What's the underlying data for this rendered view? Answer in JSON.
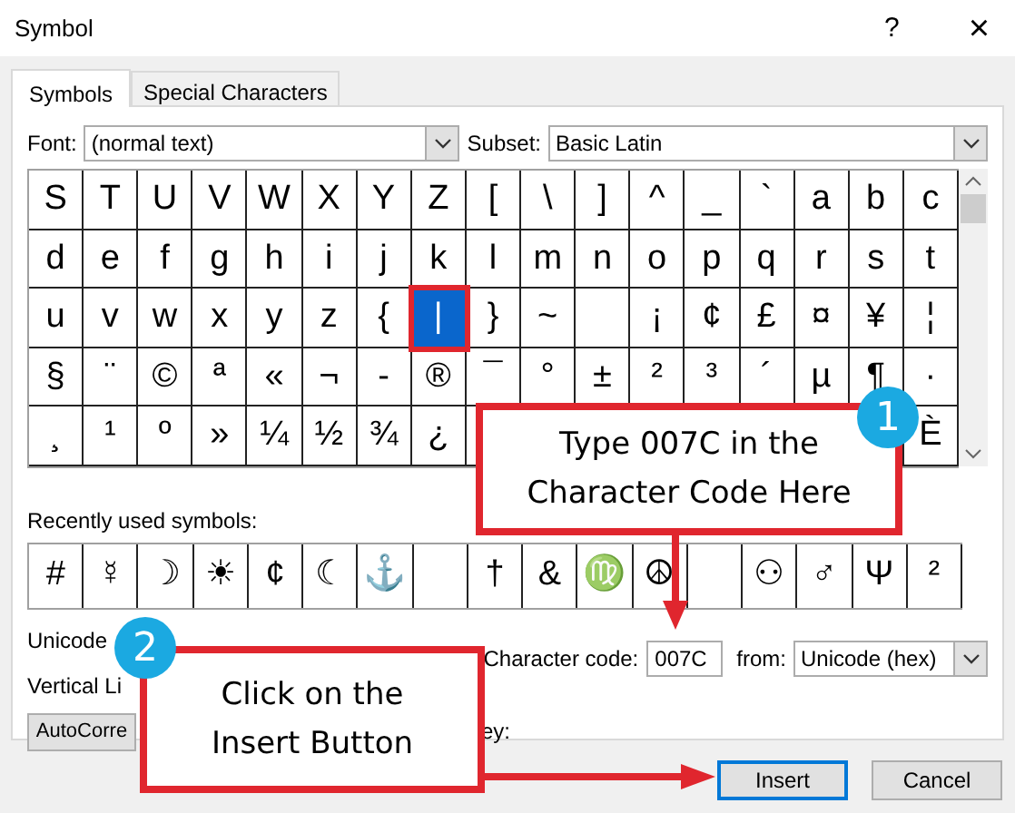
{
  "window": {
    "title": "Symbol",
    "help": "?",
    "close": "×"
  },
  "tabs": [
    {
      "label": "Symbols",
      "selected": true
    },
    {
      "label": "Special Characters",
      "selected": false
    }
  ],
  "font": {
    "label": "Font:",
    "value": "(normal text)"
  },
  "subset": {
    "label": "Subset:",
    "value": "Basic Latin"
  },
  "symbol_grid": [
    [
      {
        "c": "S",
        "selected": false
      },
      {
        "c": "T",
        "selected": false
      },
      {
        "c": "U",
        "selected": false
      },
      {
        "c": "V",
        "selected": false
      },
      {
        "c": "W",
        "selected": false
      },
      {
        "c": "X",
        "selected": false
      },
      {
        "c": "Y",
        "selected": false
      },
      {
        "c": "Z",
        "selected": false
      },
      {
        "c": "[",
        "selected": false
      },
      {
        "c": "\\",
        "selected": false
      },
      {
        "c": "]",
        "selected": false
      },
      {
        "c": "^",
        "selected": false
      },
      {
        "c": "_",
        "selected": false
      },
      {
        "c": "`",
        "selected": false
      },
      {
        "c": "a",
        "selected": false
      },
      {
        "c": "b",
        "selected": false
      },
      {
        "c": "c",
        "selected": false
      }
    ],
    [
      {
        "c": "d",
        "selected": false
      },
      {
        "c": "e",
        "selected": false
      },
      {
        "c": "f",
        "selected": false
      },
      {
        "c": "g",
        "selected": false
      },
      {
        "c": "h",
        "selected": false
      },
      {
        "c": "i",
        "selected": false
      },
      {
        "c": "j",
        "selected": false
      },
      {
        "c": "k",
        "selected": false
      },
      {
        "c": "l",
        "selected": false
      },
      {
        "c": "m",
        "selected": false
      },
      {
        "c": "n",
        "selected": false
      },
      {
        "c": "o",
        "selected": false
      },
      {
        "c": "p",
        "selected": false
      },
      {
        "c": "q",
        "selected": false
      },
      {
        "c": "r",
        "selected": false
      },
      {
        "c": "s",
        "selected": false
      },
      {
        "c": "t",
        "selected": false
      }
    ],
    [
      {
        "c": "u",
        "selected": false
      },
      {
        "c": "v",
        "selected": false
      },
      {
        "c": "w",
        "selected": false
      },
      {
        "c": "x",
        "selected": false
      },
      {
        "c": "y",
        "selected": false
      },
      {
        "c": "z",
        "selected": false
      },
      {
        "c": "{",
        "selected": false
      },
      {
        "c": "|",
        "selected": true
      },
      {
        "c": "}",
        "selected": false
      },
      {
        "c": "~",
        "selected": false
      },
      {
        "selected": false
      },
      {
        "c": "¡",
        "selected": false
      },
      {
        "c": "¢",
        "selected": false
      },
      {
        "c": "£",
        "selected": false
      },
      {
        "c": "¤",
        "selected": false
      },
      {
        "c": "¥",
        "selected": false
      },
      {
        "c": "¦",
        "selected": false
      }
    ],
    [
      {
        "c": "§",
        "selected": false
      },
      {
        "c": "¨",
        "selected": false
      },
      {
        "c": "©",
        "selected": false
      },
      {
        "c": "ª",
        "selected": false
      },
      {
        "c": "«",
        "selected": false
      },
      {
        "c": "¬",
        "selected": false
      },
      {
        "c": "-",
        "selected": false
      },
      {
        "c": "®",
        "selected": false
      },
      {
        "c": "¯",
        "selected": false
      },
      {
        "c": "°",
        "selected": false
      },
      {
        "c": "±",
        "selected": false
      },
      {
        "c": "²",
        "selected": false
      },
      {
        "c": "³",
        "selected": false
      },
      {
        "c": "´",
        "selected": false
      },
      {
        "c": "µ",
        "selected": false
      },
      {
        "c": "¶",
        "selected": false
      },
      {
        "c": "·",
        "selected": false
      }
    ],
    [
      {
        "c": "¸",
        "selected": false
      },
      {
        "c": "¹",
        "selected": false
      },
      {
        "c": "º",
        "selected": false
      },
      {
        "c": "»",
        "selected": false
      },
      {
        "c": "¼",
        "selected": false
      },
      {
        "c": "½",
        "selected": false
      },
      {
        "c": "¾",
        "selected": false
      },
      {
        "c": "¿",
        "selected": false
      },
      {
        "c": "È",
        "selected": false
      }
    ]
  ],
  "recently_used": {
    "label": "Recently used symbols:",
    "symbols": [
      {
        "kind": "symbol",
        "c": "#"
      },
      {
        "kind": "symbol",
        "c": "☿"
      },
      {
        "kind": "symbol",
        "c": "☽"
      },
      {
        "kind": "symbol",
        "c": "☀"
      },
      {
        "kind": "symbol",
        "c": "¢"
      },
      {
        "kind": "symbol",
        "c": "☾"
      },
      {
        "kind": "symbol",
        "c": "⚓"
      },
      {
        "kind": "empty"
      },
      {
        "kind": "symbol",
        "c": "†"
      },
      {
        "kind": "symbol",
        "c": "&"
      },
      {
        "kind": "symbol",
        "c": "♍"
      },
      {
        "kind": "symbol",
        "c": "☮"
      },
      {
        "kind": "empty"
      },
      {
        "kind": "symbol",
        "c": "⚇"
      },
      {
        "kind": "symbol",
        "c": "♂"
      },
      {
        "kind": "symbol",
        "c": "Ψ"
      },
      {
        "kind": "symbol",
        "c": "²"
      }
    ]
  },
  "unicode_name": {
    "label": "Unicode",
    "value": "Vertical Li"
  },
  "character_code": {
    "label": "Character code:",
    "value": "007C"
  },
  "from": {
    "label": "from:",
    "value": "Unicode (hex)"
  },
  "autocorrect_button": "AutoCorre",
  "shortcut_key_label": "ey:",
  "buttons": [
    {
      "label": "Insert",
      "default": true
    },
    {
      "label": "Cancel",
      "default": false
    }
  ],
  "callouts": [
    {
      "number": "1",
      "text": "Type 007C in the\nCharacter Code Here"
    },
    {
      "number": "2",
      "text": "Click on the\nInsert Button"
    }
  ]
}
